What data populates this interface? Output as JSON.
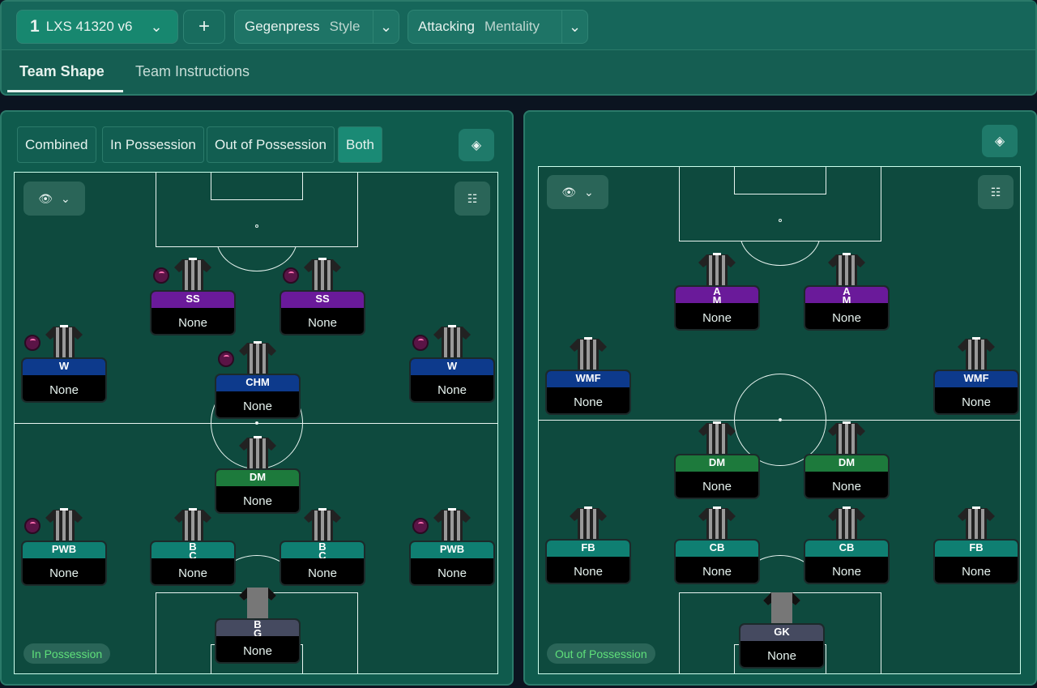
{
  "header": {
    "tactic_number": "1",
    "tactic_name": "LXS 41320 v6",
    "add_label": "+",
    "style_value": "Gegenpress",
    "style_label": "Style",
    "mentality_value": "Attacking",
    "mentality_label": "Mentality"
  },
  "tabs": [
    {
      "label": "Team Shape",
      "active": true
    },
    {
      "label": "Team Instructions",
      "active": false
    }
  ],
  "view_modes": [
    "Combined",
    "In Possession",
    "Out of Possession",
    "Both"
  ],
  "active_view": "Both",
  "left_pitch": {
    "label": "In Possession",
    "players": [
      {
        "role": "SS",
        "name": "None",
        "color": "purple",
        "badge": true
      },
      {
        "role": "SS",
        "name": "None",
        "color": "purple",
        "badge": true
      },
      {
        "role": "W",
        "name": "None",
        "color": "blue",
        "badge": true
      },
      {
        "role": "CHM",
        "name": "None",
        "color": "blue",
        "badge": true
      },
      {
        "role": "W",
        "name": "None",
        "color": "blue",
        "badge": true
      },
      {
        "role": "DM",
        "name": "None",
        "color": "green",
        "badge": false
      },
      {
        "role": "PWB",
        "name": "None",
        "color": "teal",
        "badge": true
      },
      {
        "role": "BCB",
        "name": "None",
        "color": "teal",
        "badge": false
      },
      {
        "role": "BCB",
        "name": "None",
        "color": "teal",
        "badge": false
      },
      {
        "role": "PWB",
        "name": "None",
        "color": "teal",
        "badge": true
      },
      {
        "role": "BGK",
        "name": "None",
        "color": "gk",
        "badge": false
      }
    ]
  },
  "right_pitch": {
    "label": "Out of Possession",
    "players": [
      {
        "role": "AM",
        "name": "None",
        "color": "purple",
        "badge": false
      },
      {
        "role": "AM",
        "name": "None",
        "color": "purple",
        "badge": false
      },
      {
        "role": "WMF",
        "name": "None",
        "color": "blue",
        "badge": false
      },
      {
        "role": "WMF",
        "name": "None",
        "color": "blue",
        "badge": false
      },
      {
        "role": "DM",
        "name": "None",
        "color": "green",
        "badge": false
      },
      {
        "role": "DM",
        "name": "None",
        "color": "green",
        "badge": false
      },
      {
        "role": "FB",
        "name": "None",
        "color": "teal",
        "badge": false
      },
      {
        "role": "CB",
        "name": "None",
        "color": "teal",
        "badge": false
      },
      {
        "role": "CB",
        "name": "None",
        "color": "teal",
        "badge": false
      },
      {
        "role": "FB",
        "name": "None",
        "color": "teal",
        "badge": false
      },
      {
        "role": "GK",
        "name": "None",
        "color": "gk",
        "badge": false
      }
    ]
  },
  "colors": {
    "purple": "#6a1a9a",
    "blue": "#0d3a8c",
    "green": "#1d7a3c",
    "teal": "#0f7f72",
    "gk": "#454a60",
    "accent": "#1a8a75"
  }
}
